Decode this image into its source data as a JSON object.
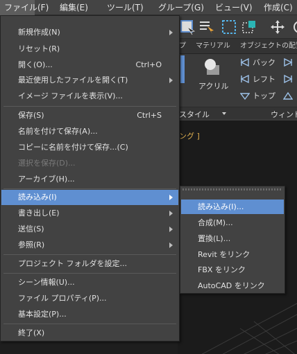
{
  "menubar": {
    "file": "ファイル(F)",
    "edit": "編集(E)",
    "tools": "ツール(T)",
    "group": "グループ(G)",
    "view": "ビュー(V)",
    "create": "作成(C)"
  },
  "ribbon_tabs": [
    "プ",
    "マテリアル",
    "オブジェクトの配置"
  ],
  "ribbon": {
    "acrylic": "アクリル",
    "back": "バック",
    "left": "レフト",
    "top": "トップ",
    "style": "スタイル",
    "window": "ウィンド"
  },
  "viewport": {
    "label": "ング ]"
  },
  "file_menu": {
    "items": [
      {
        "label": "新規作成(N)",
        "submenu": true
      },
      {
        "label": "リセット(R)"
      },
      {
        "label": "開く(O)...",
        "shortcut": "Ctrl+O"
      },
      {
        "label": "最近使用したファイルを開く(T)",
        "submenu": true
      },
      {
        "label": "イメージ ファイルを表示(V)..."
      },
      {
        "label": "保存(S)",
        "shortcut": "Ctrl+S"
      },
      {
        "label": "名前を付けて保存(A)..."
      },
      {
        "label": "コピーに名前を付けて保存...(C)"
      },
      {
        "label": "選択を保存(D)...",
        "disabled": true
      },
      {
        "label": "アーカイブ(H)..."
      },
      {
        "label": "読み込み(I)",
        "submenu": true,
        "highlighted": true
      },
      {
        "label": "書き出し(E)",
        "submenu": true
      },
      {
        "label": "送信(S)",
        "submenu": true
      },
      {
        "label": "参照(R)",
        "submenu": true
      },
      {
        "label": "プロジェクト フォルダを設定..."
      },
      {
        "label": "シーン情報(U)..."
      },
      {
        "label": "ファイル プロパティ(P)..."
      },
      {
        "label": "基本設定(P)..."
      },
      {
        "label": "終了(X)"
      }
    ]
  },
  "import_menu": {
    "items": [
      {
        "label": "読み込み(I)...",
        "highlighted": true
      },
      {
        "label": "合成(M)..."
      },
      {
        "label": "置換(L)..."
      },
      {
        "label": "Revit をリンク"
      },
      {
        "label": "FBX をリンク"
      },
      {
        "label": "AutoCAD をリンク"
      }
    ]
  },
  "colors": {
    "menu_bg": "#424242",
    "highlight": "#5f8fd1",
    "menubar_bg": "#444444",
    "disabled_text": "#7a7a7a"
  }
}
